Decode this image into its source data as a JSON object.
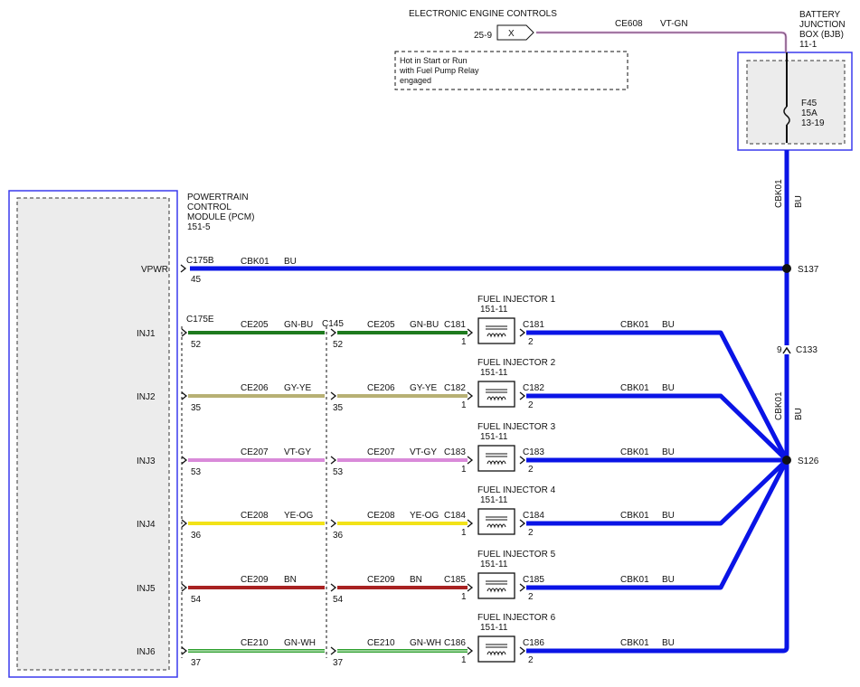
{
  "eec": {
    "title": "ELECTRONIC ENGINE CONTROLS",
    "pin": "25-9",
    "connector_symbol": "X",
    "circuit": "CE608",
    "color_code": "VT-GN",
    "note": [
      "Hot in Start or Run",
      "with Fuel Pump Relay",
      "engaged"
    ]
  },
  "bjb": {
    "title": [
      "BATTERY",
      "JUNCTION",
      "BOX (BJB)",
      "11-1"
    ],
    "fuse": [
      "F45",
      "15A",
      "13-19"
    ]
  },
  "pcm": {
    "title": [
      "POWERTRAIN",
      "CONTROL",
      "MODULE (PCM)",
      "151-5"
    ]
  },
  "vpwr": {
    "label": "VPWR",
    "connector": "C175B",
    "pin": "45",
    "circuit": "CBK01",
    "color_code": "BU",
    "splice": "S137"
  },
  "vertical_bus": {
    "upper_circuit": "CBK01",
    "upper_color": "BU",
    "lower_circuit": "CBK01",
    "lower_color": "BU",
    "inline_connector": "C133",
    "inline_pin": "9",
    "splice": "S126"
  },
  "pcm_connector": "C175E",
  "inline_connector": "C145",
  "injector_part_ref": "151-11",
  "injectors": [
    {
      "pcm_label": "INJ1",
      "pcm_pin": "52",
      "circuit": "CE205",
      "color_code": "GN-BU",
      "inline_pin": "52",
      "connector": "C181",
      "pin_in": "1",
      "pin_out": "2",
      "name": "FUEL  INJECTOR 1",
      "ground_circuit": "CBK01",
      "ground_color": "BU"
    },
    {
      "pcm_label": "INJ2",
      "pcm_pin": "35",
      "circuit": "CE206",
      "color_code": "GY-YE",
      "inline_pin": "35",
      "connector": "C182",
      "pin_in": "1",
      "pin_out": "2",
      "name": "FUEL  INJECTOR 2",
      "ground_circuit": "CBK01",
      "ground_color": "BU"
    },
    {
      "pcm_label": "INJ3",
      "pcm_pin": "53",
      "circuit": "CE207",
      "color_code": "VT-GY",
      "inline_pin": "53",
      "connector": "C183",
      "pin_in": "1",
      "pin_out": "2",
      "name": "FUEL  INJECTOR 3",
      "ground_circuit": "CBK01",
      "ground_color": "BU"
    },
    {
      "pcm_label": "INJ4",
      "pcm_pin": "36",
      "circuit": "CE208",
      "color_code": "YE-OG",
      "inline_pin": "36",
      "connector": "C184",
      "pin_in": "1",
      "pin_out": "2",
      "name": "FUEL  INJECTOR 4",
      "ground_circuit": "CBK01",
      "ground_color": "BU"
    },
    {
      "pcm_label": "INJ5",
      "pcm_pin": "54",
      "circuit": "CE209",
      "color_code": "BN",
      "inline_pin": "54",
      "connector": "C185",
      "pin_in": "1",
      "pin_out": "2",
      "name": "FUEL  INJECTOR 5",
      "ground_circuit": "CBK01",
      "ground_color": "BU"
    },
    {
      "pcm_label": "INJ6",
      "pcm_pin": "37",
      "circuit": "CE210",
      "color_code": "GN-WH",
      "inline_pin": "37",
      "connector": "C186",
      "pin_in": "1",
      "pin_out": "2",
      "name": "FUEL  INJECTOR 6",
      "ground_circuit": "CBK01",
      "ground_color": "BU"
    }
  ],
  "colors": {
    "bu": "#0a14e6",
    "vt_gn": "#c98fc9",
    "module_border": "#3a3aee",
    "module_fill": "#ececec",
    "GN-BU": "#1e7a1e",
    "GY-YE": "#b7b074",
    "VT-GY": "#d98ad9",
    "YE-OG": "#f2e218",
    "BN": "#a82222",
    "GN-WH": "#2ea02e"
  }
}
